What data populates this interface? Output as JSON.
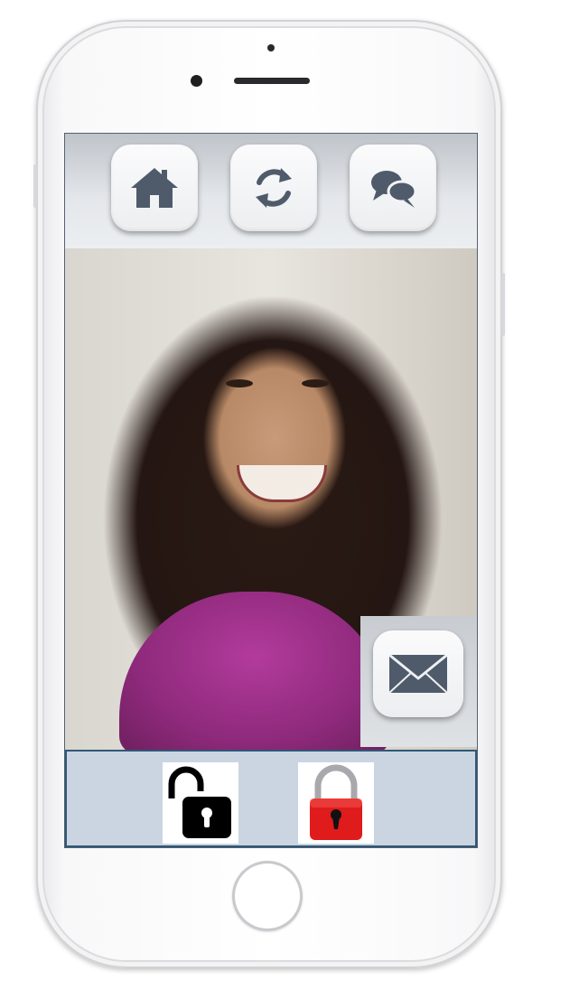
{
  "device": {
    "icons": {
      "front_camera": "camera-dot-icon",
      "earpiece": "speaker-grille-icon",
      "home": "home-button-icon"
    }
  },
  "toolbar": {
    "buttons": [
      {
        "name": "home",
        "icon": "house-icon"
      },
      {
        "name": "refresh",
        "icon": "refresh-arrows-icon"
      },
      {
        "name": "chat",
        "icon": "chat-bubbles-icon"
      }
    ],
    "icon_color": "#4f5b6b"
  },
  "video": {
    "content": "video-feed-of-smiling-woman"
  },
  "message_button": {
    "icon": "envelope-icon"
  },
  "lock_bar": {
    "unlock_icon": "unlocked-padlock-icon",
    "lock_icon": "locked-padlock-icon",
    "lock_color": "#e01b1b",
    "bar_color": "#cbd5e2"
  }
}
